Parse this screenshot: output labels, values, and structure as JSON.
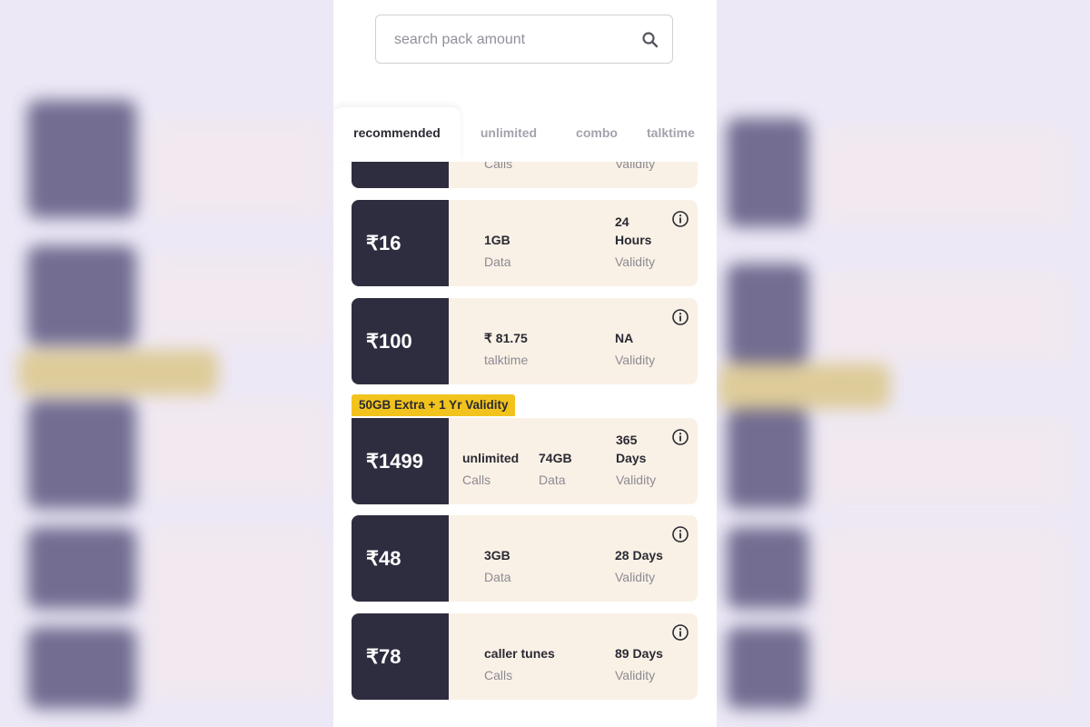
{
  "search": {
    "placeholder": "search pack amount"
  },
  "tabs": [
    {
      "label": "recommended",
      "active": true
    },
    {
      "label": "unlimited",
      "active": false
    },
    {
      "label": "combo",
      "active": false
    },
    {
      "label": "talktime",
      "active": false
    }
  ],
  "packs": {
    "partial": {
      "col1_label": "Calls",
      "col2_label": "Validity"
    },
    "p16": {
      "price": "₹16",
      "a_val": "1GB",
      "a_lab": "Data",
      "b_val1": "24",
      "b_val2": "Hours",
      "b_lab": "Validity"
    },
    "p100": {
      "price": "₹100",
      "a_val": "₹ 81.75",
      "a_lab": "talktime",
      "b_val": "NA",
      "b_lab": "Validity"
    },
    "p1499": {
      "badge": "50GB Extra + 1 Yr Validity",
      "price": "₹1499",
      "a_val": "unlimited",
      "a_lab": "Calls",
      "c_val": "74GB",
      "c_lab": "Data",
      "b_val1": "365",
      "b_val2": "Days",
      "b_lab": "Validity"
    },
    "p48": {
      "price": "₹48",
      "a_val": "3GB",
      "a_lab": "Data",
      "b_val": "28 Days",
      "b_lab": "Validity"
    },
    "p78": {
      "price": "₹78",
      "a_val": "caller tunes",
      "a_lab": "Calls",
      "b_val": "89 Days",
      "b_lab": "Validity"
    }
  },
  "colors": {
    "price_bg": "#2e2d40",
    "card_bg": "#faf1e6",
    "badge_bg": "#f2c31c"
  }
}
